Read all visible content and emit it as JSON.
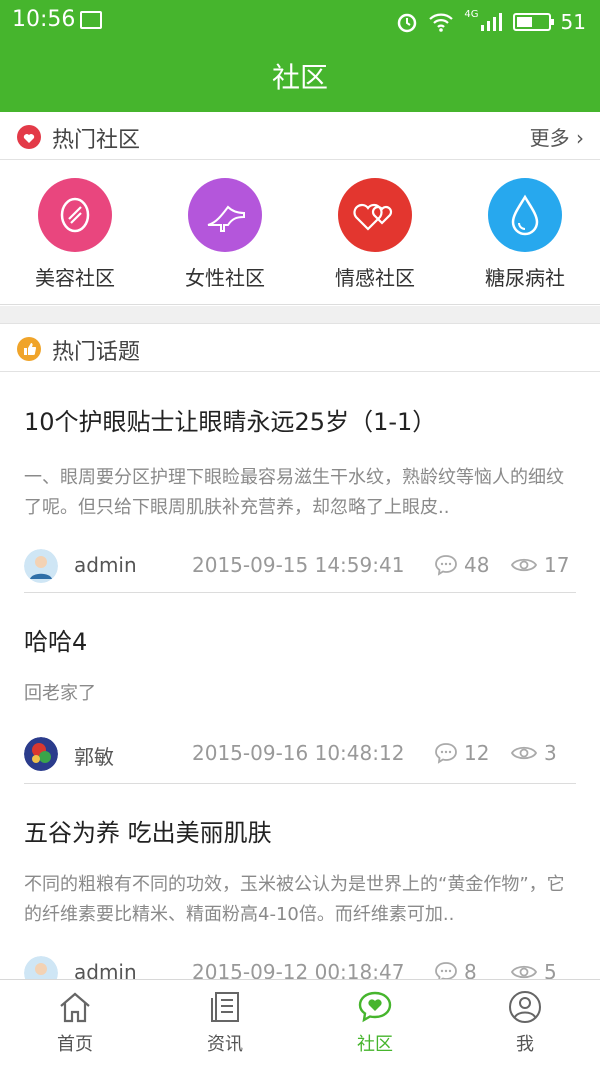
{
  "status": {
    "time": "10:56",
    "network": "4G",
    "battery": "51",
    "battery_level": 0.51
  },
  "header": {
    "title": "社区"
  },
  "hot_communities": {
    "title": "热门社区",
    "more": "更多",
    "items": [
      {
        "label": "美容社区",
        "icon": "beauty-icon",
        "color": "#e9467e"
      },
      {
        "label": "女性社区",
        "icon": "high-heel-icon",
        "color": "#b456db"
      },
      {
        "label": "情感社区",
        "icon": "hearts-icon",
        "color": "#e3362f"
      },
      {
        "label": "糖尿病社",
        "icon": "drop-icon",
        "color": "#27a8ee"
      }
    ]
  },
  "hot_topics": {
    "title": "热门话题",
    "posts": [
      {
        "title": "10个护眼贴士让眼睛永远25岁（1-1）",
        "desc": "一、眼周要分区护理下眼睑最容易滋生干水纹，熟龄纹等恼人的细纹了呢。但只给下眼周肌肤补充营养，却忽略了上眼皮..",
        "author": "admin",
        "date": "2015-09-15 14:59:41",
        "comments": "48",
        "views": "17"
      },
      {
        "title": "哈哈4",
        "desc": "回老家了",
        "author": "郭敏",
        "date": "2015-09-16 10:48:12",
        "comments": "12",
        "views": "3"
      },
      {
        "title": "五谷为养 吃出美丽肌肤",
        "desc": "不同的粗粮有不同的功效，玉米被公认为是世界上的“黄金作物”，它的纤维素要比精米、精面粉高4-10倍。而纤维素可加..",
        "author": "admin",
        "date": "2015-09-12 00:18:47",
        "comments": "8",
        "views": "5"
      }
    ]
  },
  "tabbar": {
    "items": [
      {
        "label": "首页",
        "icon": "home-icon"
      },
      {
        "label": "资讯",
        "icon": "news-icon"
      },
      {
        "label": "社区",
        "icon": "community-icon",
        "active": true
      },
      {
        "label": "我",
        "icon": "profile-icon"
      }
    ]
  },
  "colors": {
    "primary": "#46b52d",
    "muted": "#999999"
  }
}
